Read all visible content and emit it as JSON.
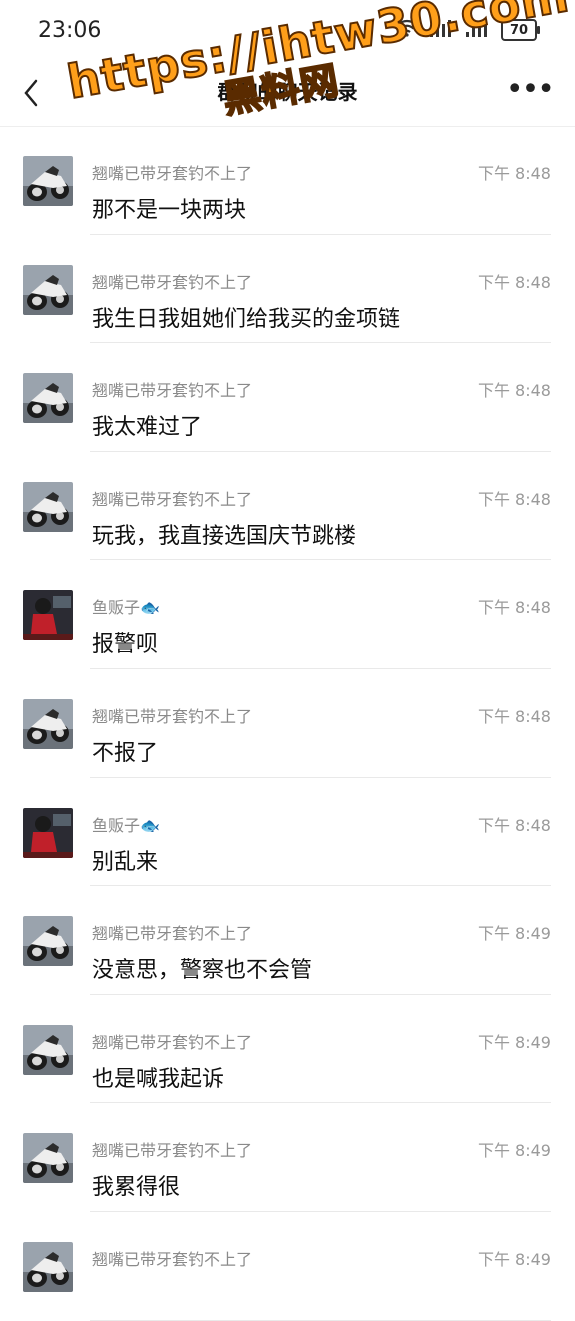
{
  "status_bar": {
    "time": "23:06",
    "battery": "70"
  },
  "header": {
    "title": "群聊的聊天记录"
  },
  "watermark": {
    "url": "https://ihtw30.com",
    "subtitle": "黑料网"
  },
  "messages": [
    {
      "sender": "翘嘴已带牙套钓不上了",
      "time": "下午 8:48",
      "text": "那不是一块两块",
      "avatar": "motorcycle"
    },
    {
      "sender": "翘嘴已带牙套钓不上了",
      "time": "下午 8:48",
      "text": "我生日我姐她们给我买的金项链",
      "avatar": "motorcycle"
    },
    {
      "sender": "翘嘴已带牙套钓不上了",
      "time": "下午 8:48",
      "text": "我太难过了",
      "avatar": "motorcycle"
    },
    {
      "sender": "翘嘴已带牙套钓不上了",
      "time": "下午 8:48",
      "text": "玩我，我直接选国庆节跳楼",
      "avatar": "motorcycle"
    },
    {
      "sender": "鱼贩子🐟",
      "time": "下午 8:48",
      "text": "报警呗",
      "avatar": "red-rider"
    },
    {
      "sender": "翘嘴已带牙套钓不上了",
      "time": "下午 8:48",
      "text": "不报了",
      "avatar": "motorcycle"
    },
    {
      "sender": "鱼贩子🐟",
      "time": "下午 8:48",
      "text": "别乱来",
      "avatar": "red-rider"
    },
    {
      "sender": "翘嘴已带牙套钓不上了",
      "time": "下午 8:49",
      "text": "没意思，警察也不会管",
      "avatar": "motorcycle"
    },
    {
      "sender": "翘嘴已带牙套钓不上了",
      "time": "下午 8:49",
      "text": "也是喊我起诉",
      "avatar": "motorcycle"
    },
    {
      "sender": "翘嘴已带牙套钓不上了",
      "time": "下午 8:49",
      "text": "我累得很",
      "avatar": "motorcycle"
    },
    {
      "sender": "翘嘴已带牙套钓不上了",
      "time": "下午 8:49",
      "text": "",
      "avatar": "motorcycle"
    }
  ]
}
